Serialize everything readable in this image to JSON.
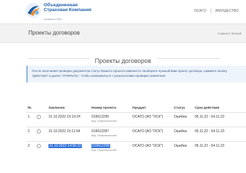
{
  "header": {
    "logo_line1": "Объединенная",
    "logo_line2": "Страховая Компания",
    "logo_sub": "Основана в 1993 г.",
    "nav": [
      "ОСАГО",
      "ИМУЩЕСТВО"
    ]
  },
  "page": {
    "title": "Проекты договоров",
    "breadcrumb": "Главная | Личный"
  },
  "section_title": "Проекты договоров",
  "alert": {
    "text": "После окончания проверки документов статус Вашего проекта изменится. Выберите нужный Вам проект договора, нажмите кнопку \"Действия\" и далее \"ОТКРЫТЬ\", чтобы ознакомиться с результатами проверки заявления."
  },
  "table": {
    "columns": [
      "№",
      "",
      "Заключен",
      "Номер проекта",
      "Продукт",
      "Статус",
      "Срок действия"
    ],
    "rows": [
      {
        "num": "1",
        "date": "31.10.2022 15:19:24",
        "number": "019612295",
        "number_sub": "Вид: Первоначальный",
        "product": "ОСАГО (АО \"ОСК\")",
        "status": "Ошибка",
        "term": "05.11.22 - 04.11.23"
      },
      {
        "num": "2",
        "date": "31.10.2022 15:11:54",
        "number": "019612287",
        "number_sub": "Вид: Первоначальный",
        "product": "ОСАГО (АО \"ОСК\")",
        "status": "Ошибка",
        "term": "05.11.22 - 04.11.23"
      },
      {
        "num": "3",
        "date": "31.10.2022 14:56:22",
        "number": "019612258",
        "number_sub": "Вид: Первоначальный",
        "product": "ОСАГО (АО \"ОСК\")",
        "status": "Ошибка",
        "term": "05.11.22 - 04.11.23"
      }
    ]
  },
  "colors": {
    "brand": "#1f5fa8",
    "selection": "#2f6fd6",
    "titlebar_bg": "#f2f2f2",
    "alert_bg": "#eef4fb"
  }
}
